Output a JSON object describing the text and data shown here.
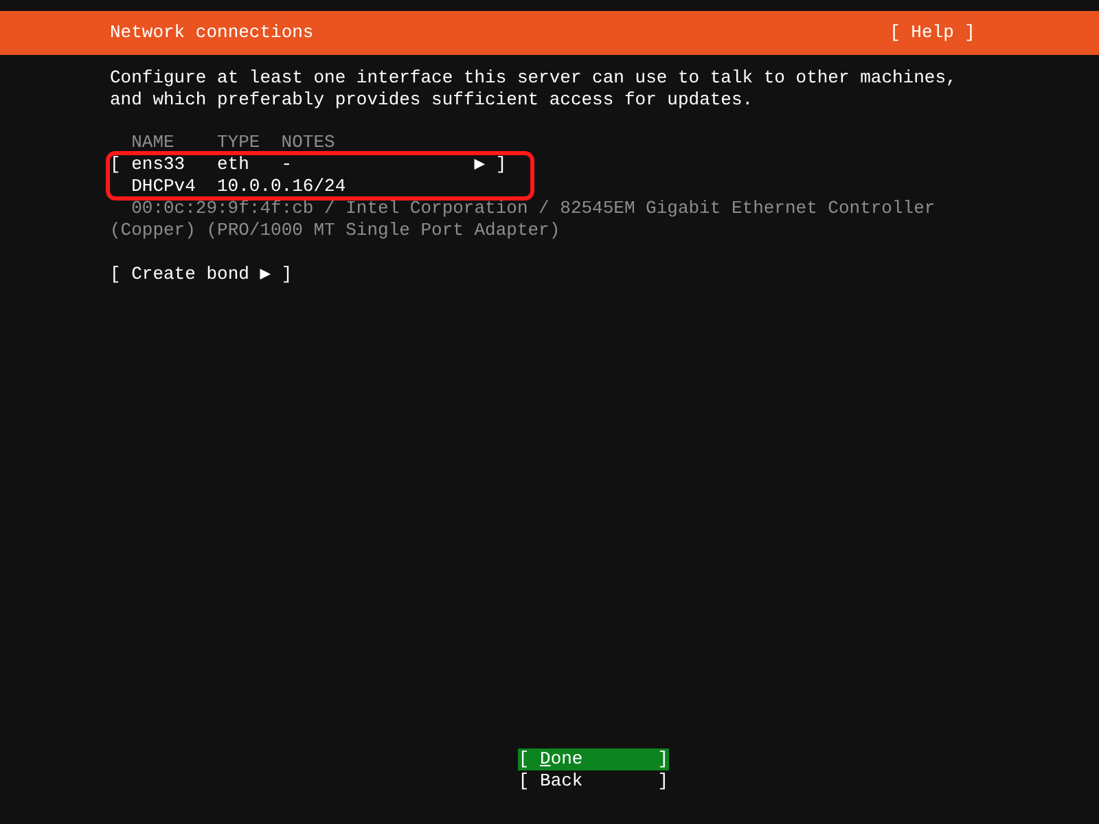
{
  "header": {
    "title": "Network connections",
    "help": "[ Help ]"
  },
  "intro": [
    "Configure at least one interface this server can use to talk to other machines,",
    "and which preferably provides sufficient access for updates."
  ],
  "table": {
    "columns": [
      "NAME",
      "TYPE",
      "NOTES"
    ],
    "devices": [
      {
        "name": "ens33",
        "type": "eth",
        "notes": "-",
        "arrow": "▶",
        "open": "[",
        "close": "]",
        "highlighted": true,
        "addresses": [
          {
            "method": "DHCPv4",
            "address": "10.0.0.16/24"
          }
        ],
        "description": [
          "00:0c:29:9f:4f:cb / Intel Corporation / 82545EM Gigabit Ethernet Controller",
          "(Copper) (PRO/1000 MT Single Port Adapter)"
        ]
      }
    ]
  },
  "create_bond": "[ Create bond ▶ ]",
  "buttons": [
    {
      "open": "[",
      "label": "Done",
      "close": "]",
      "selected": true
    },
    {
      "open": "[",
      "label": "Back",
      "close": "]",
      "selected": false
    }
  ]
}
